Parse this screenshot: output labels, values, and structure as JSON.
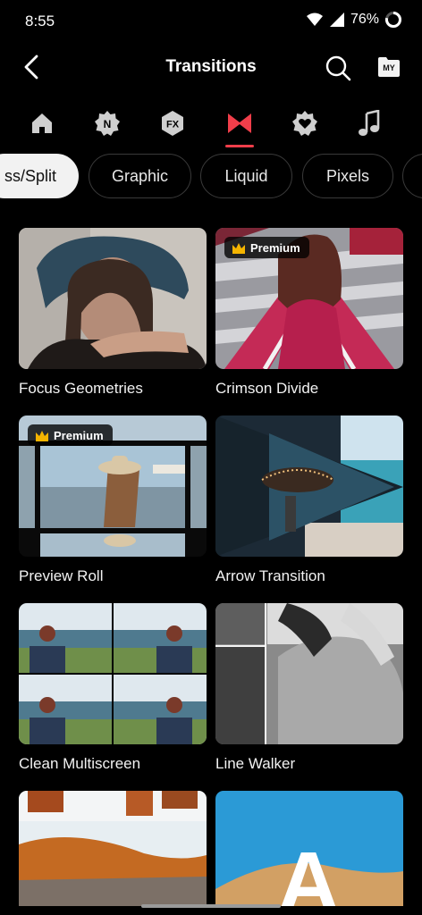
{
  "status": {
    "time": "8:55",
    "battery": "76%"
  },
  "header": {
    "title": "Transitions",
    "my_label": "MY"
  },
  "category_tabs": [
    {
      "name": "home",
      "icon": "home-icon"
    },
    {
      "name": "new",
      "icon": "new-badge-icon",
      "badge": "N"
    },
    {
      "name": "effects",
      "icon": "fx-badge-icon",
      "badge": "FX"
    },
    {
      "name": "transitions",
      "icon": "bowtie-icon",
      "active": true
    },
    {
      "name": "favorites",
      "icon": "heart-badge-icon"
    },
    {
      "name": "music",
      "icon": "music-note-icon"
    }
  ],
  "colors": {
    "accent": "#f03e4a",
    "premium_crown": "#f4b400"
  },
  "chips": [
    "ss/Split",
    "Graphic",
    "Liquid",
    "Pixels"
  ],
  "premium_label": "Premium",
  "cards": [
    {
      "label": "Focus Geometries"
    },
    {
      "label": "Crimson Divide",
      "premium": true
    },
    {
      "label": "Preview Roll",
      "premium": true
    },
    {
      "label": "Arrow Transition"
    },
    {
      "label": "Clean Multiscreen"
    },
    {
      "label": "Line Walker"
    },
    {
      "label": ""
    },
    {
      "label": "",
      "overlay_letter": "A"
    }
  ]
}
